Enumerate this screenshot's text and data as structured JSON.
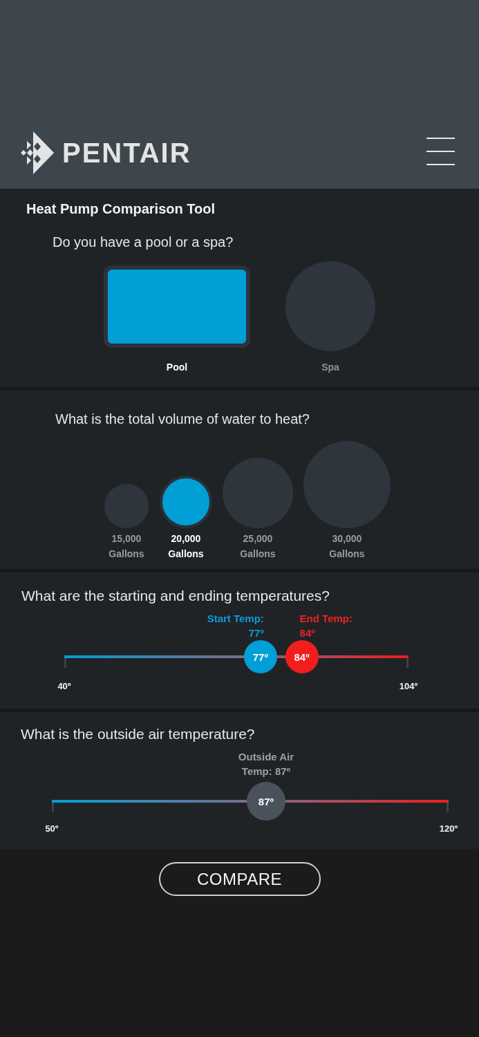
{
  "header": {
    "brand": "PENTAIR"
  },
  "tool_title": "Heat Pump Comparison Tool",
  "water_type": {
    "question": "Do you have a pool or a spa?",
    "options": [
      {
        "kind": "rectangle",
        "label": "Pool",
        "selected": true
      },
      {
        "kind": "circle",
        "label": "Spa",
        "selected": false
      }
    ]
  },
  "volume": {
    "question": "What is the total volume of water to heat?",
    "options": [
      {
        "label": "15,000 Gallons",
        "selected": false
      },
      {
        "label": "20,000 Gallons",
        "selected": true
      },
      {
        "label": "25,000 Gallons",
        "selected": false
      },
      {
        "label": "30,000 Gallons",
        "selected": false
      }
    ]
  },
  "temperatures": {
    "question": "What are the starting and ending temperatures?",
    "thumbs": [
      {
        "kind": "start",
        "label": "Start Temp: 77º",
        "value": "77º",
        "level": 0.57
      },
      {
        "kind": "end",
        "label": "End Temp: 84º",
        "value": "84º",
        "level": 0.69
      }
    ],
    "min_label": "40º",
    "max_label": "104º"
  },
  "outside_air": {
    "question": "What is the outside air temperature?",
    "thumbs": [
      {
        "kind": "neutral",
        "label": "Outside Air Temp: 87º",
        "value": "87º",
        "level": 0.54
      }
    ],
    "min_label": "50º",
    "max_label": "120º"
  },
  "compare_button": "COMPARE"
}
